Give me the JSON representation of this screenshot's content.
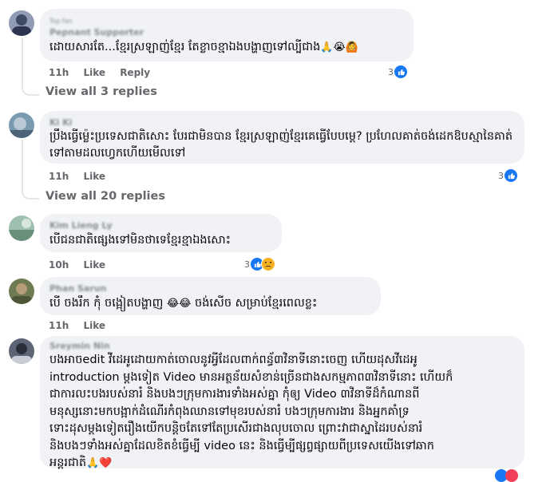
{
  "comments": [
    {
      "author": "Pepnant Supporter",
      "badge": "Top fan",
      "text": "ដោយសារតែ...ខ្មែរស្រឡាញ់ខ្មែរ តែខ្លាចខ្មាឯងបង្ហាញទៅល្បីជាង",
      "emojis": "🙏😭🙆",
      "time": "11h",
      "like": "Like",
      "reply": "Reply",
      "reaction_count": "3",
      "view_replies": "View all 3 replies",
      "avatar_color": "#8f9cb3"
    },
    {
      "author": "Ki Ki",
      "text": "ប្រឹងធ្វើម្ល៉េះប្រទេសជាតិសោះ បែរជាមិនបាន ខ្មែរស្រឡាញ់ខ្មែរគេធ្វើបែបម្ដេ? ប្រហែលគាត់ចង់ដេកឱបស្មានៃគាត់ទៅតាមដលហ្វេកហើយមើលទៅ",
      "time": "11h",
      "like": "Like",
      "reaction_count": "3",
      "view_replies": "View all 20 replies",
      "avatar_color": "#7a9ab0"
    },
    {
      "author": "Kim Lieng Ly",
      "text": "បើជនជាតិផ្សេងទៅមិនថាទេខ្មែរខ្មាឯងសោះ",
      "time": "10h",
      "like": "Like",
      "reaction_count": "3",
      "avatar_color": "#8fb0a0"
    },
    {
      "author": "Phan Sarun",
      "text": "បើ ចងរឹក កុំ ចង្អៀតបង្ហាញ",
      "emojis": "😂😂",
      "text_after": "ចង់សើច សម្រាប់ខ្មែរពេលខ្លះ",
      "time": "11h",
      "like": "Like",
      "avatar_color": "#6e7a52"
    },
    {
      "author": "Sreymin Nin",
      "lines": [
        "បងអាចedit វីដេអូដោយកាត់ចោលនូវអ្វីដែលពាក់ពន្ធ័៣វិនាទីនោះចេញ ហើយដុសវីដេអូ",
        "introduction ម្តងទៀត Video មានអត្ថន័យសំខាន់ច្រើនជាងសកម្មភាព៣វិនាទីនោះ ហើយក៏",
        "ជាការលះបងរបស់នារំ និងបងៗក្រុមការងារទាំងអស់គ្នា កុំឲ្យ Video ៣វិនាទីដ៏កំណានពី",
        "មនុស្សនោះមកបង្អាក់ដំណើរកំពុងឈានទៅមុខរបស់នារំ បងៗក្រុមការងារ និងអ្នកគាំទ្រ",
        "ទោះដុសម្តងទៀតរឿងយើកបន្តិចតែទៅតែប្រសើរជាងលុបចោល ព្រោះវាជាស្នាដៃរបស់នារំ",
        "និងបងៗទាំងអស់គ្នាដែលខិតខំធ្វើម្បី video នេះ និងធ្វើម្បីផ្សព្វផ្សាយពីប្រទេសយើងទៅឆាក",
        "អន្តរជាតិ"
      ],
      "emojis": "🙏❤️",
      "avatar_color": "#5d6475"
    }
  ]
}
